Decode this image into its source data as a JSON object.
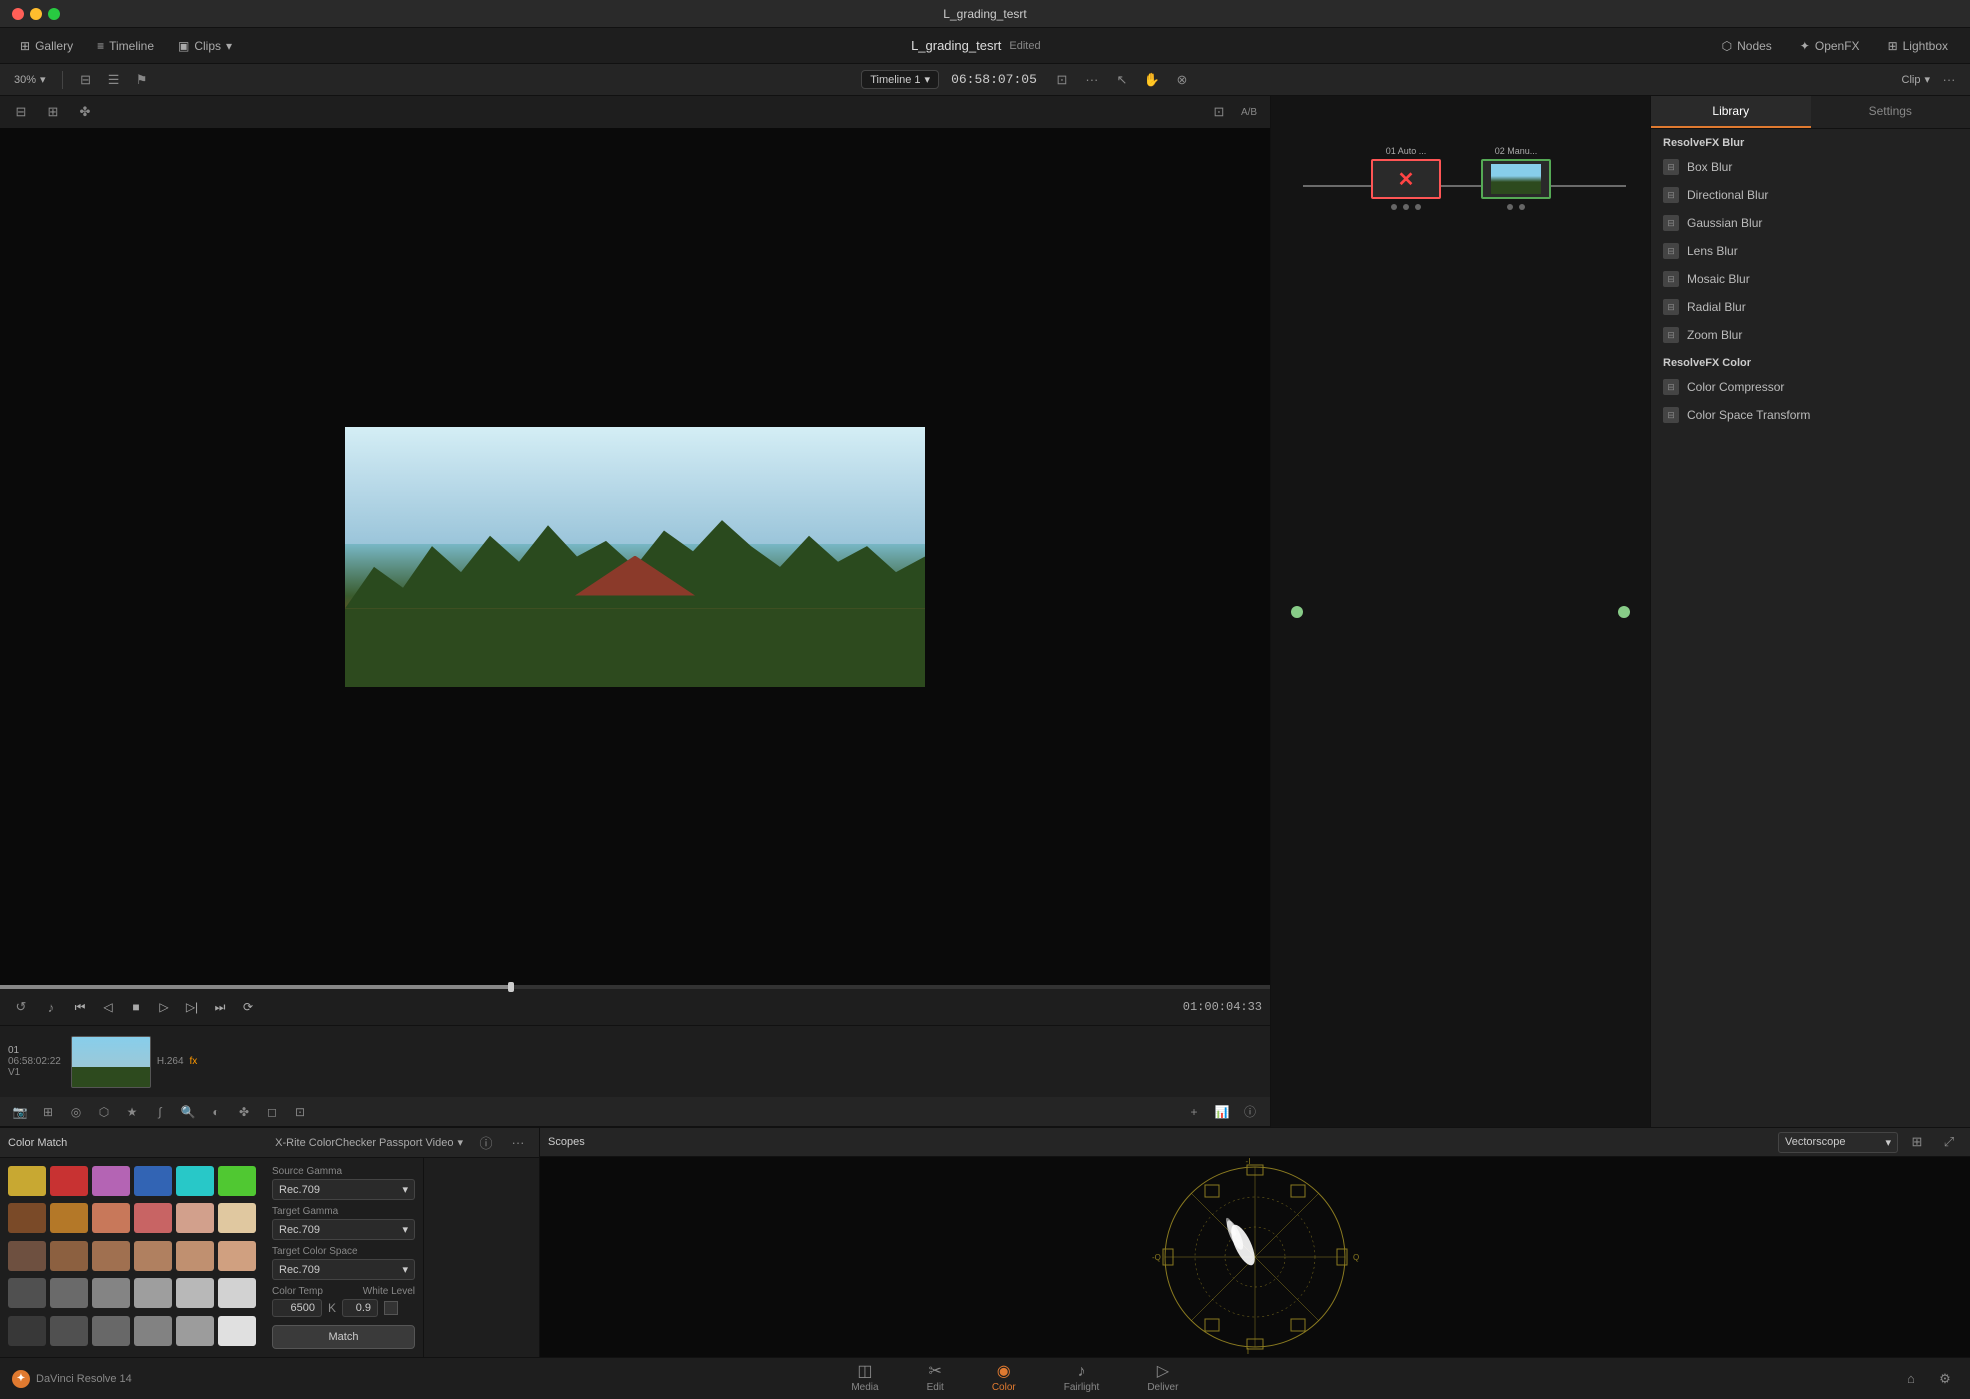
{
  "app": {
    "title": "L_grading_tesrt",
    "project": "L_grading_tesrt",
    "edited": "Edited"
  },
  "titlebar": {
    "controls": [
      "red",
      "yellow",
      "green"
    ]
  },
  "topnav": {
    "gallery": "Gallery",
    "timeline": "Timeline",
    "clips": "Clips",
    "nodes": "Nodes",
    "openfx": "OpenFX",
    "lightbox": "Lightbox"
  },
  "toolbar": {
    "zoom": "30%",
    "timeline_name": "Timeline 1",
    "timecode": "06:58:07:05",
    "clip_label": "Clip",
    "playback_time": "01:00:04:33"
  },
  "clip": {
    "number": "01",
    "timecode": "06:58:02:22",
    "track": "V1",
    "codec": "H.264",
    "fx": "fx"
  },
  "nodes": {
    "node1_label": "01 Auto ...",
    "node2_label": "02 Manu..."
  },
  "openfx": {
    "library_tab": "Library",
    "settings_tab": "Settings",
    "sections": [
      {
        "title": "ResolveFX Blur",
        "items": [
          "Box Blur",
          "Directional Blur",
          "Gaussian Blur",
          "Lens Blur",
          "Mosaic Blur",
          "Radial Blur",
          "Zoom Blur"
        ]
      },
      {
        "title": "ResolveFX Color",
        "items": [
          "Color Compressor",
          "Color Space Transform"
        ]
      }
    ]
  },
  "color_match": {
    "panel_title": "Color Match",
    "selector_label": "X-Rite ColorChecker Passport Video",
    "swatches": [
      "#c8a832",
      "#c83232",
      "#b464b4",
      "#3264b4",
      "#28c8c8",
      "#50c832",
      "#7a4a28",
      "#b47828",
      "#c8785a",
      "#c86464",
      "#d2a08c",
      "#e0c8a0",
      "#6e5040",
      "#8c6040",
      "#a07050",
      "#b08060",
      "#c09070",
      "#d0a080",
      "#505050",
      "#6a6a6a",
      "#848484",
      "#9e9e9e",
      "#b8b8b8",
      "#d2d2d2",
      "#383838",
      "#505050",
      "#686868",
      "#828282",
      "#9c9c9c",
      "#e0e0e0"
    ],
    "source_gamma_label": "Source Gamma",
    "source_gamma_value": "Rec.709",
    "target_gamma_label": "Target Gamma",
    "target_gamma_value": "Rec.709",
    "target_color_space_label": "Target Color Space",
    "target_color_space_value": "Rec.709",
    "color_temp_label": "Color Temp",
    "white_level_label": "White Level",
    "color_temp_value": "6500",
    "color_temp_unit": "K",
    "white_level_value": "0.9",
    "match_btn": "Match"
  },
  "scopes": {
    "panel_title": "Scopes",
    "scope_type": "Vectorscope"
  },
  "bottom_nav": {
    "items": [
      {
        "label": "Media",
        "icon": "◫",
        "active": false
      },
      {
        "label": "Edit",
        "icon": "✂",
        "active": false
      },
      {
        "label": "Color",
        "icon": "◉",
        "active": true
      },
      {
        "label": "Fairlight",
        "icon": "♪",
        "active": false
      },
      {
        "label": "Deliver",
        "icon": "▷",
        "active": false
      }
    ],
    "app_name": "DaVinci Resolve 14"
  }
}
